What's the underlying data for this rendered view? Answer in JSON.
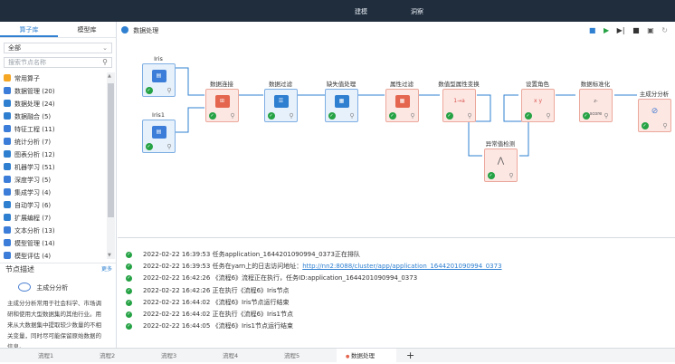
{
  "topbar": {
    "item1": "建模",
    "item2": "洞察"
  },
  "leftpanel": {
    "tabs": [
      "算子库",
      "模型库"
    ],
    "select_value": "全部",
    "search_placeholder": "搜索节点名称",
    "categories": [
      {
        "label": "常用算子",
        "icon": "star-icon",
        "color": "#f5a623"
      },
      {
        "label": "数据管理 (20)",
        "icon": "database-icon",
        "color": "#3b7dd8"
      },
      {
        "label": "数据处理 (24)",
        "icon": "process-icon",
        "color": "#2f7fd1"
      },
      {
        "label": "数据融合 (5)",
        "icon": "merge-icon",
        "color": "#2f7fd1"
      },
      {
        "label": "特征工程 (11)",
        "icon": "feature-icon",
        "color": "#3b7dd8"
      },
      {
        "label": "统计分析 (7)",
        "icon": "stats-icon",
        "color": "#3b7dd8"
      },
      {
        "label": "图表分析 (12)",
        "icon": "chart-icon",
        "color": "#2f7fd1"
      },
      {
        "label": "机器学习 (51)",
        "icon": "robot-icon",
        "color": "#2f7fd1"
      },
      {
        "label": "深度学习 (5)",
        "icon": "deep-learning-icon",
        "color": "#3b7dd8"
      },
      {
        "label": "集成学习 (4)",
        "icon": "ensemble-icon",
        "color": "#3b7dd8"
      },
      {
        "label": "自动学习 (6)",
        "icon": "auto-icon",
        "color": "#2f7fd1"
      },
      {
        "label": "扩展编程 (7)",
        "icon": "code-icon",
        "color": "#2f7fd1"
      },
      {
        "label": "文本分析 (13)",
        "icon": "text-icon",
        "color": "#3b7dd8"
      },
      {
        "label": "模型管理 (14)",
        "icon": "model-icon",
        "color": "#3b7dd8"
      },
      {
        "label": "模型评估 (4)",
        "icon": "eval-icon",
        "color": "#3b7dd8"
      }
    ],
    "desc": {
      "title": "节点描述",
      "more": "更多",
      "node_name": "主成分分析",
      "text": "主成分分析常用于社会科学、市场调研和使用大型数据集的其他行业。用来从大数据集中提取较少数量的不相关变量，同时尽可能保留原始数据的信息。"
    }
  },
  "canvas": {
    "title": "数据处理",
    "nodes": {
      "iris": "Iris",
      "iris1": "Iris1",
      "join": "数据连接",
      "filter": "数据过滤",
      "missing": "缺失值处理",
      "attr_filter": "属性过滤",
      "num_convert": "数值型属性变换",
      "role": "设置角色",
      "normalize": "数据标准化",
      "pca": "主成分分析",
      "outlier": "异常值检测"
    },
    "num_convert_glyph": "1→a",
    "zscore_glyph": "z-score",
    "xy_glyph": "x y"
  },
  "logs": [
    {
      "text": "2022-02-22 16:39:53 任务application_1644201090994_0373正在排队"
    },
    {
      "text": "2022-02-22 16:39:53 任务在yarn上的日志访问地址：",
      "link": "http://nn2:8088/cluster/app/application_1644201090994_0373"
    },
    {
      "text": "2022-02-22 16:42:26 《流程6》流程正在执行，任务ID:application_1644201090994_0373"
    },
    {
      "text": "2022-02-22 16:42:26 正在执行《流程6》Iris节点"
    },
    {
      "text": "2022-02-22 16:44:02 《流程6》Iris节点运行结束"
    },
    {
      "text": "2022-02-22 16:44:02 正在执行《流程6》Iris1节点"
    },
    {
      "text": "2022-02-22 16:44:05 《流程6》Iris1节点运行结束"
    }
  ],
  "bottom_tabs": [
    "流程1",
    "流程2",
    "流程3",
    "流程4",
    "流程5",
    "数据处理"
  ],
  "plus": "+"
}
